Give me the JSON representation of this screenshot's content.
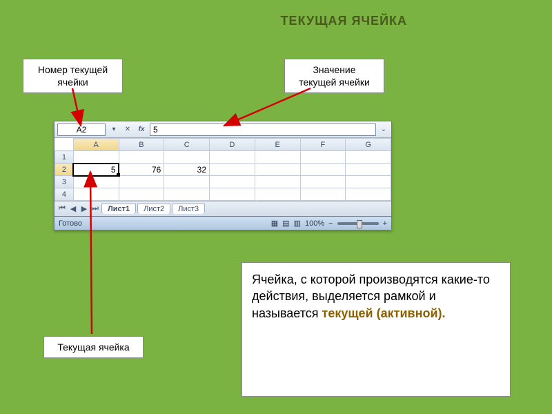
{
  "slide_title": "ТЕКУЩАЯ ЯЧЕЙКА",
  "callouts": {
    "top_left": "Номер текущей ячейки",
    "top_right": "Значение текущей ячейки",
    "bottom_left": "Текущая ячейка"
  },
  "explanation": {
    "part1": "Ячейка, с которой производятся  какие-то действия, выделяется рамкой и называется ",
    "highlight": "текущей (активной).",
    "part2": ""
  },
  "excel": {
    "name_box": "A2",
    "formula_value": "5",
    "columns": [
      "A",
      "B",
      "C",
      "D",
      "E",
      "F",
      "G"
    ],
    "rows": [
      {
        "n": "1",
        "cells": [
          "",
          "",
          "",
          "",
          "",
          "",
          ""
        ]
      },
      {
        "n": "2",
        "cells": [
          "5",
          "76",
          "32",
          "",
          "",
          "",
          ""
        ]
      },
      {
        "n": "3",
        "cells": [
          "",
          "",
          "",
          "",
          "",
          "",
          ""
        ]
      },
      {
        "n": "4",
        "cells": [
          "",
          "",
          "",
          "",
          "",
          "",
          ""
        ]
      }
    ],
    "active": {
      "row_index": 1,
      "col_index": 0
    },
    "sheet_tabs": [
      "Лист1",
      "Лист2",
      "Лист3"
    ],
    "active_tab": 0,
    "status": "Готово",
    "zoom": "100%",
    "zoom_minus": "−",
    "zoom_plus": "+"
  }
}
